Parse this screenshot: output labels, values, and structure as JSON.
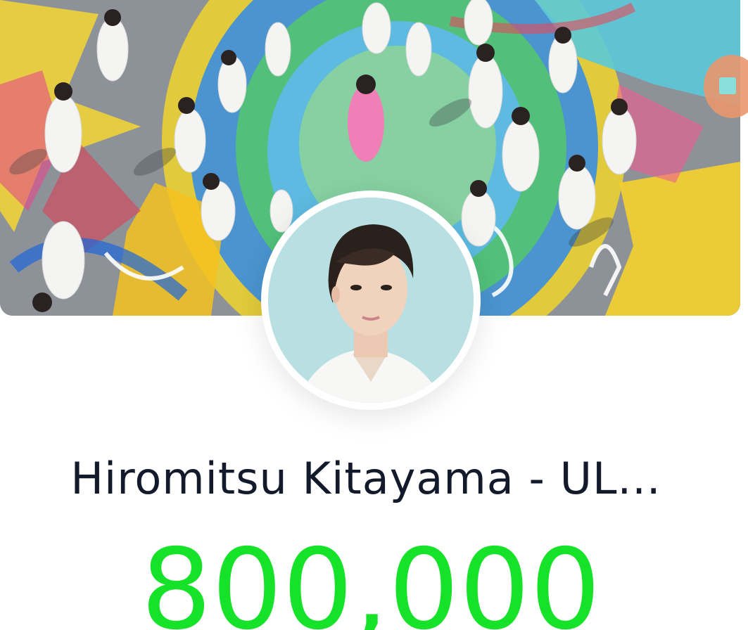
{
  "profile": {
    "title": "Hiromitsu Kitayama - UL...",
    "count": "800,000",
    "count_color": "#17e22a",
    "banner_image": "crowd-dancing-on-painted-pavement",
    "avatar_image": "profile-portrait"
  },
  "icons": {
    "side_handle": "expand-handle-icon"
  }
}
